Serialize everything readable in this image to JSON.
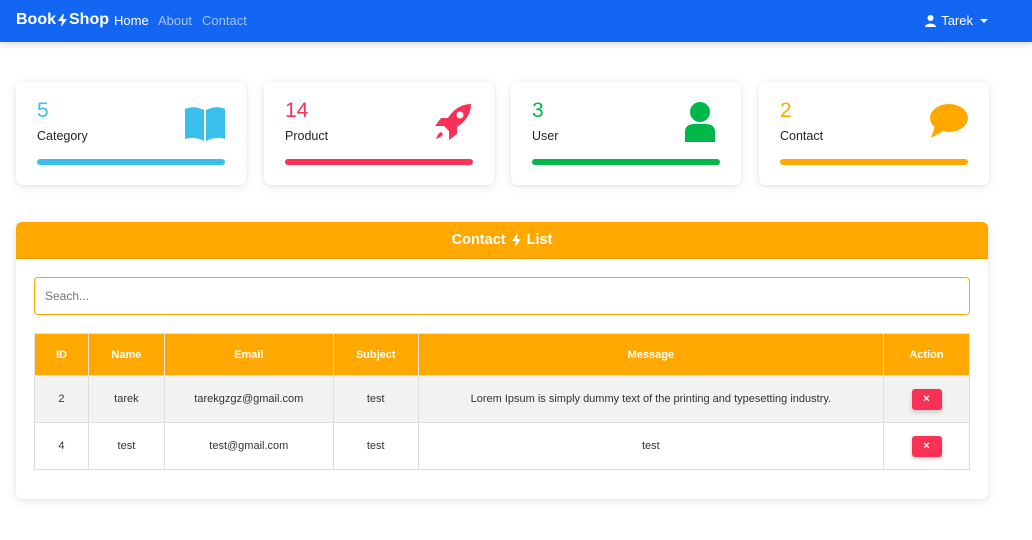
{
  "navbar": {
    "brand_left": "Book",
    "brand_right": "Shop",
    "links": [
      "Home",
      "About",
      "Contact"
    ],
    "user": "Tarek"
  },
  "stats": [
    {
      "count": "5",
      "label": "Category",
      "color": "#39c0ed",
      "icon": "book-open-icon"
    },
    {
      "count": "14",
      "label": "Product",
      "color": "#f93154",
      "icon": "rocket-icon"
    },
    {
      "count": "3",
      "label": "User",
      "color": "#00b74a",
      "icon": "user-icon"
    },
    {
      "count": "2",
      "label": "Contact",
      "color": "#ffa900",
      "icon": "comment-icon"
    }
  ],
  "contact_panel": {
    "title_left": "Contact",
    "title_right": "List",
    "search_placeholder": "Seach...",
    "columns": [
      "ID",
      "Name",
      "Email",
      "Subject",
      "Message",
      "Action"
    ],
    "rows": [
      {
        "id": "2",
        "name": "tarek",
        "email": "tarekgzgz@gmail.com",
        "subject": "test",
        "message": "Lorem Ipsum is simply dummy text of the printing and typesetting industry.",
        "action": "×"
      },
      {
        "id": "4",
        "name": "test",
        "email": "test@gmail.com",
        "subject": "test",
        "message": "test",
        "action": "×"
      }
    ]
  }
}
